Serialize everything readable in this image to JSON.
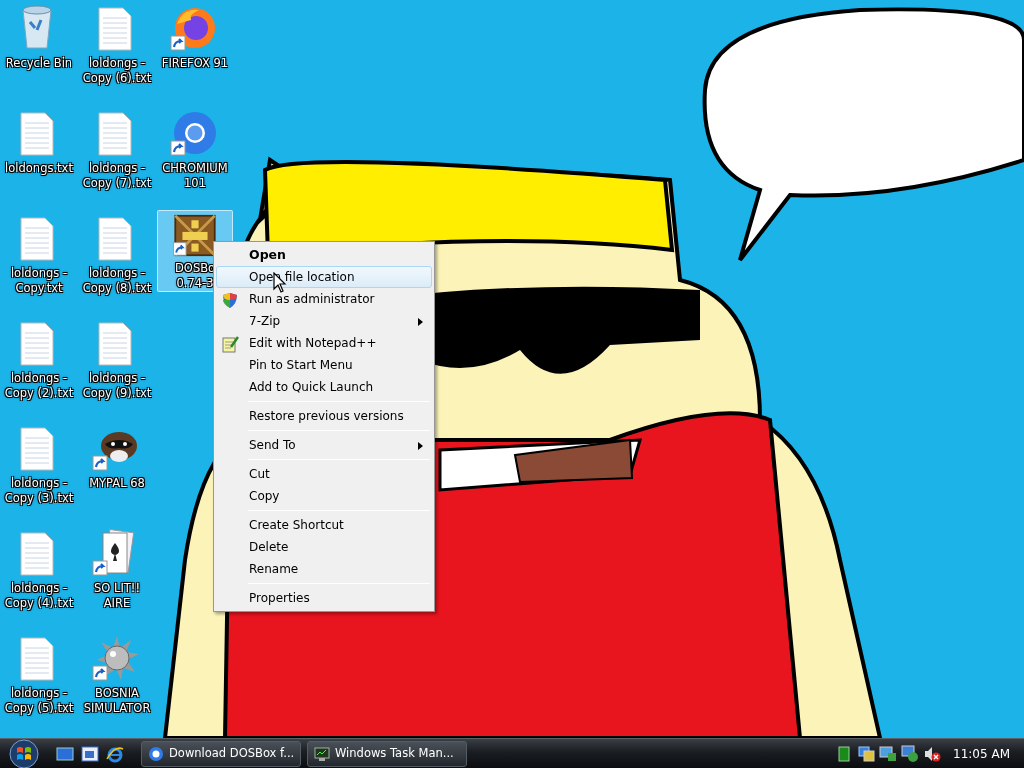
{
  "desktop": {
    "columns": [
      {
        "icons": [
          {
            "label": "Recycle Bin",
            "kind": "recycle-bin",
            "shortcut": false,
            "selected": false
          },
          {
            "label": "loldongs.txt",
            "kind": "text-file",
            "shortcut": false,
            "selected": false
          },
          {
            "label": "loldongs - Copy.txt",
            "kind": "text-file",
            "shortcut": false,
            "selected": false
          },
          {
            "label": "loldongs - Copy (2).txt",
            "kind": "text-file",
            "shortcut": false,
            "selected": false
          },
          {
            "label": "loldongs - Copy (3).txt",
            "kind": "text-file",
            "shortcut": false,
            "selected": false
          },
          {
            "label": "loldongs - Copy (4).txt",
            "kind": "text-file",
            "shortcut": false,
            "selected": false
          },
          {
            "label": "loldongs - Copy (5).txt",
            "kind": "text-file",
            "shortcut": false,
            "selected": false
          }
        ]
      },
      {
        "icons": [
          {
            "label": "loldongs - Copy (6).txt",
            "kind": "text-file",
            "shortcut": false,
            "selected": false
          },
          {
            "label": "loldongs - Copy (7).txt",
            "kind": "text-file",
            "shortcut": false,
            "selected": false
          },
          {
            "label": "loldongs - Copy (8).txt",
            "kind": "text-file",
            "shortcut": false,
            "selected": false
          },
          {
            "label": "loldongs - Copy (9).txt",
            "kind": "text-file",
            "shortcut": false,
            "selected": false
          },
          {
            "label": "MYPAL 68",
            "kind": "raccoon",
            "shortcut": true,
            "selected": false
          },
          {
            "label": "SO LIT!! AIRE",
            "kind": "cards",
            "shortcut": true,
            "selected": false
          },
          {
            "label": "BOSNIA SIMULATOR",
            "kind": "mine",
            "shortcut": true,
            "selected": false
          }
        ]
      },
      {
        "icons": [
          {
            "label": "FIREFOX 91",
            "kind": "firefox",
            "shortcut": true,
            "selected": false
          },
          {
            "label": "CHROMIUM 101",
            "kind": "chromium",
            "shortcut": true,
            "selected": false
          },
          {
            "label": "DOSBo 0.74-3",
            "kind": "dosbox",
            "shortcut": true,
            "selected": true
          }
        ]
      }
    ]
  },
  "context_menu": {
    "items": [
      {
        "kind": "item",
        "label": "Open",
        "default": true,
        "selected": false,
        "submenu": false
      },
      {
        "kind": "item",
        "label": "Open file location",
        "default": false,
        "selected": true,
        "submenu": false
      },
      {
        "kind": "shield-item",
        "label": "Run as administrator",
        "default": false,
        "selected": false,
        "submenu": false
      },
      {
        "kind": "item",
        "label": "7-Zip",
        "default": false,
        "selected": false,
        "submenu": true
      },
      {
        "kind": "notepad-item",
        "label": "Edit with Notepad++",
        "default": false,
        "selected": false,
        "submenu": false
      },
      {
        "kind": "item",
        "label": "Pin to Start Menu",
        "default": false,
        "selected": false,
        "submenu": false
      },
      {
        "kind": "item",
        "label": "Add to Quick Launch",
        "default": false,
        "selected": false,
        "submenu": false
      },
      {
        "kind": "separator"
      },
      {
        "kind": "item",
        "label": "Restore previous versions",
        "default": false,
        "selected": false,
        "submenu": false
      },
      {
        "kind": "separator"
      },
      {
        "kind": "item",
        "label": "Send To",
        "default": false,
        "selected": false,
        "submenu": true
      },
      {
        "kind": "separator"
      },
      {
        "kind": "item",
        "label": "Cut",
        "default": false,
        "selected": false,
        "submenu": false
      },
      {
        "kind": "item",
        "label": "Copy",
        "default": false,
        "selected": false,
        "submenu": false
      },
      {
        "kind": "separator"
      },
      {
        "kind": "item",
        "label": "Create Shortcut",
        "default": false,
        "selected": false,
        "submenu": false
      },
      {
        "kind": "item",
        "label": "Delete",
        "default": false,
        "selected": false,
        "submenu": false
      },
      {
        "kind": "item",
        "label": "Rename",
        "default": false,
        "selected": false,
        "submenu": false
      },
      {
        "kind": "separator"
      },
      {
        "kind": "item",
        "label": "Properties",
        "default": false,
        "selected": false,
        "submenu": false
      }
    ]
  },
  "taskbar": {
    "tasks": [
      {
        "label": "Download DOSBox f...",
        "kind": "chromium"
      },
      {
        "label": "Windows Task Man...",
        "kind": "monitor"
      }
    ],
    "clock": "11:05 AM"
  }
}
